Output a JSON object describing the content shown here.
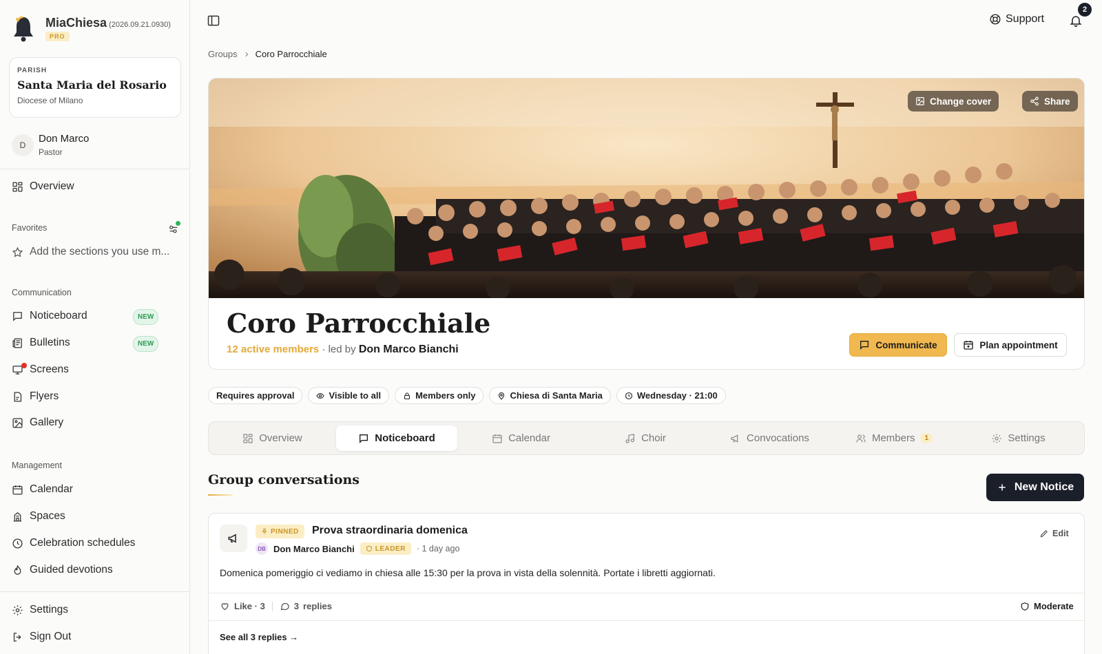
{
  "app": {
    "name": "MiaChiesa",
    "version": "(2026.09.21.0930)",
    "plan_badge": "PRO"
  },
  "parish": {
    "label": "PARISH",
    "name": "Santa Maria del Rosario",
    "diocese": "Diocese of Milano"
  },
  "user": {
    "initial": "D",
    "name": "Don Marco",
    "role": "Pastor"
  },
  "sidebar": {
    "overview": "Overview",
    "favorites_label": "Favorites",
    "favorites_hint": "Add the sections you use m...",
    "communication_label": "Communication",
    "communication": [
      {
        "label": "Noticeboard",
        "badge": "NEW",
        "icon": "message-square-icon"
      },
      {
        "label": "Bulletins",
        "badge": "NEW",
        "icon": "newspaper-icon"
      },
      {
        "label": "Screens",
        "icon": "monitor-icon"
      },
      {
        "label": "Flyers",
        "icon": "file-icon"
      },
      {
        "label": "Gallery",
        "icon": "image-icon"
      }
    ],
    "management_label": "Management",
    "management": [
      {
        "label": "Calendar",
        "icon": "calendar-icon"
      },
      {
        "label": "Spaces",
        "icon": "building-icon"
      },
      {
        "label": "Celebration schedules",
        "icon": "clock-icon"
      },
      {
        "label": "Guided devotions",
        "icon": "flame-icon"
      }
    ],
    "settings": "Settings",
    "sign_out": "Sign Out"
  },
  "topbar": {
    "support": "Support",
    "notification_count": "2"
  },
  "breadcrumb": {
    "parent": "Groups",
    "current": "Coro Parrocchiale"
  },
  "cover": {
    "change_cover": "Change cover",
    "share": "Share"
  },
  "group": {
    "title": "Coro Parrocchiale",
    "active_members": "12 active members",
    "led_by": "· led by",
    "leader": "Don Marco Bianchi",
    "communicate": "Communicate",
    "plan_appointment": "Plan appointment"
  },
  "chips": [
    {
      "label": "Requires approval",
      "icon": ""
    },
    {
      "label": "Visible to all",
      "icon": "eye-icon"
    },
    {
      "label": "Members only",
      "icon": "lock-icon"
    },
    {
      "label": "Chiesa di Santa Maria",
      "icon": "map-pin-icon"
    },
    {
      "label": "Wednesday · 21:00",
      "icon": "clock-icon"
    }
  ],
  "tabs": [
    {
      "label": "Overview",
      "icon": "grid-icon"
    },
    {
      "label": "Noticeboard",
      "icon": "message-square-icon",
      "active": true
    },
    {
      "label": "Calendar",
      "icon": "calendar-icon"
    },
    {
      "label": "Choir",
      "icon": "music-icon"
    },
    {
      "label": "Convocations",
      "icon": "megaphone-icon"
    },
    {
      "label": "Members",
      "icon": "users-icon",
      "count": "1"
    },
    {
      "label": "Settings",
      "icon": "gear-icon"
    }
  ],
  "conversations": {
    "title": "Group conversations",
    "new_notice": "New Notice"
  },
  "post": {
    "pinned": "PINNED",
    "title": "Prova straordinaria domenica",
    "author_initials": "DB",
    "author": "Don Marco Bianchi",
    "author_badge": "LEADER",
    "time": "· 1 day ago",
    "edit": "Edit",
    "body": "Domenica pomeriggio ci vediamo in chiesa alle 15:30 per la prova in vista della solennità. Portate i libretti aggiornati.",
    "like": "Like · 3",
    "replies_count": "3",
    "replies_label": "replies",
    "moderate": "Moderate",
    "see_all": "See all 3 replies →"
  },
  "colors": {
    "accent": "#f0b84e",
    "dark": "#1b1f2a",
    "success": "#2e9b57",
    "alert": "#e0312b"
  }
}
